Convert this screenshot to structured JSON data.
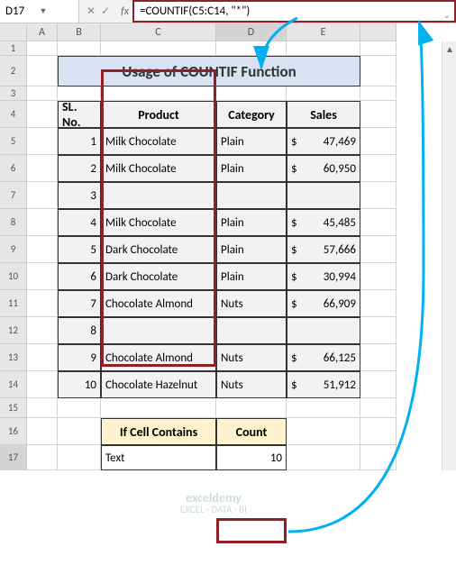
{
  "name_box": "D17",
  "formula": "=COUNTIF(C5:C14, \"*\")",
  "columns": [
    "A",
    "B",
    "C",
    "D",
    "E"
  ],
  "title": "Usage of COUNTIF Function",
  "headers": {
    "sl": "SL. No.",
    "product": "Product",
    "category": "Category",
    "sales": "Sales"
  },
  "rows": [
    {
      "n": "1",
      "product": "Milk Chocolate",
      "category": "Plain",
      "sales": "47,469"
    },
    {
      "n": "2",
      "product": "Milk Chocolate",
      "category": "Plain",
      "sales": "60,950"
    },
    {
      "n": "3",
      "product": "",
      "category": "",
      "sales": ""
    },
    {
      "n": "4",
      "product": "Milk Chocolate",
      "category": "Plain",
      "sales": "45,485"
    },
    {
      "n": "5",
      "product": "Dark Chocolate",
      "category": "Plain",
      "sales": "57,666"
    },
    {
      "n": "6",
      "product": "Dark Chocolate",
      "category": "Plain",
      "sales": "30,994"
    },
    {
      "n": "7",
      "product": "Chocolate Almond",
      "category": "Nuts",
      "sales": "66,909"
    },
    {
      "n": "8",
      "product": "",
      "category": "",
      "sales": ""
    },
    {
      "n": "9",
      "product": "Chocolate Almond",
      "category": "Nuts",
      "sales": "66,125"
    },
    {
      "n": "10",
      "product": "Chocolate Hazelnut",
      "category": "Nuts",
      "sales": "51,912"
    }
  ],
  "result": {
    "label1": "If Cell Contains",
    "label2": "Count",
    "text": "Text",
    "count": "10"
  },
  "watermark": {
    "brand": "exceldemy",
    "tag": "EXCEL · DATA · BI"
  }
}
